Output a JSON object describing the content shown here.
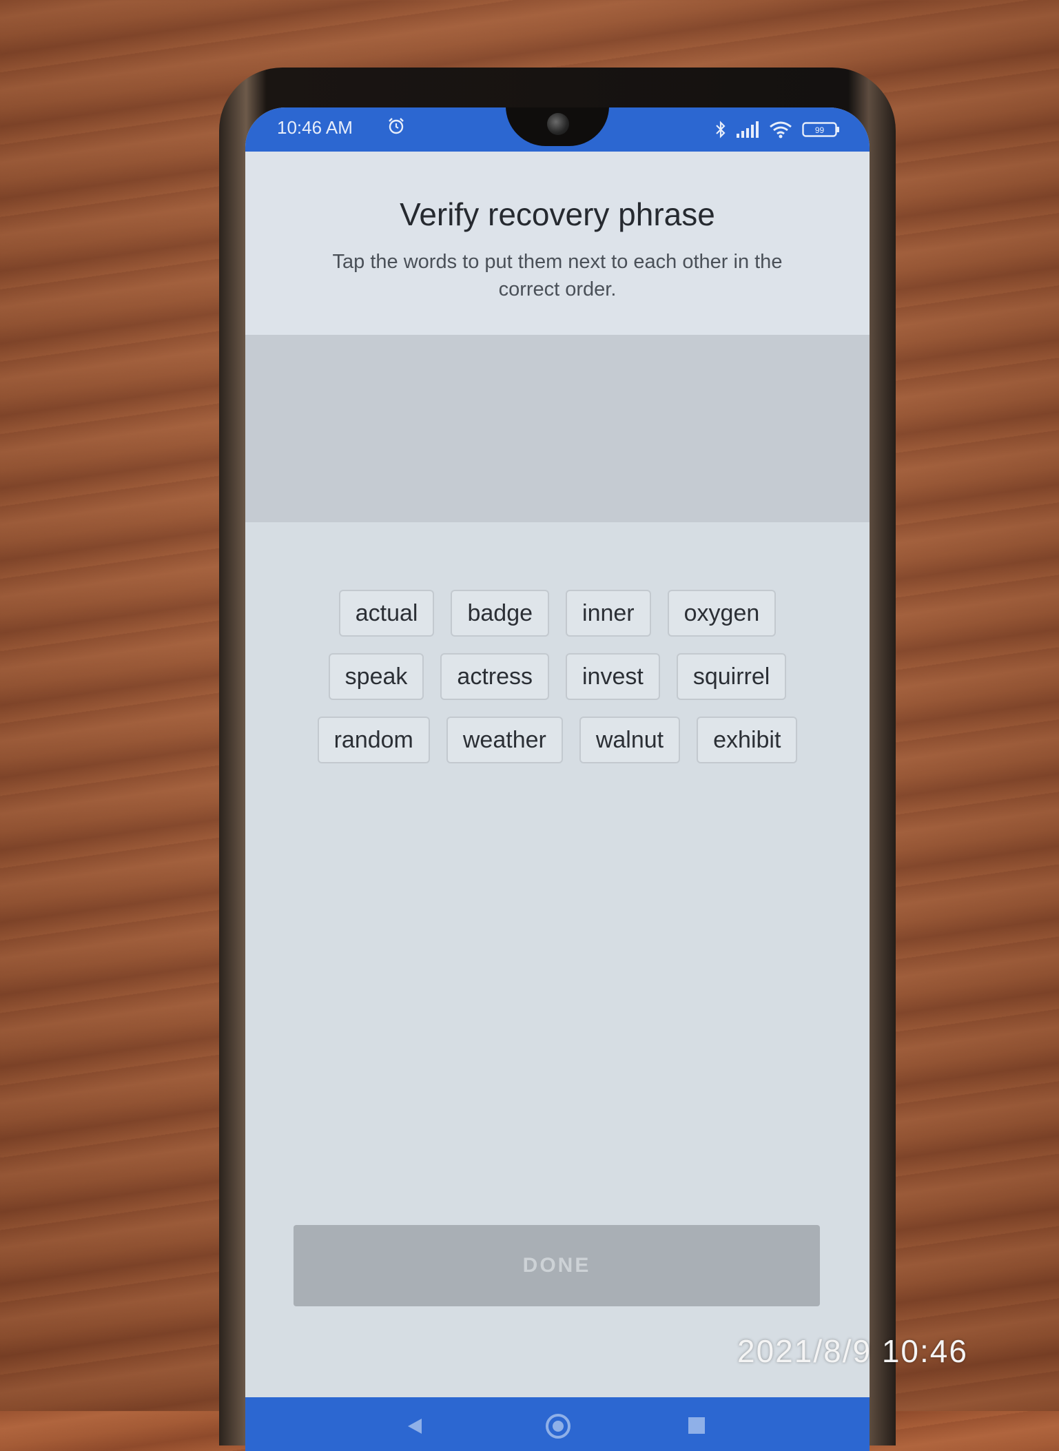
{
  "status_bar": {
    "time": "10:46 AM",
    "battery": "99"
  },
  "screen": {
    "title": "Verify recovery phrase",
    "subtitle": "Tap the words to put them next to each other in the correct order.",
    "words": [
      "actual",
      "badge",
      "inner",
      "oxygen",
      "speak",
      "actress",
      "invest",
      "squirrel",
      "random",
      "weather",
      "walnut",
      "exhibit"
    ],
    "done_label": "DONE"
  },
  "photo_timestamp": "2021/8/9  10:46",
  "colors": {
    "status_bar": "#2c67d1",
    "done_disabled": "#a9afb5"
  },
  "icons": [
    "alarm-icon",
    "bluetooth-icon",
    "signal-icon",
    "wifi-icon",
    "battery-icon",
    "back-icon",
    "home-icon",
    "recent-apps-icon"
  ]
}
